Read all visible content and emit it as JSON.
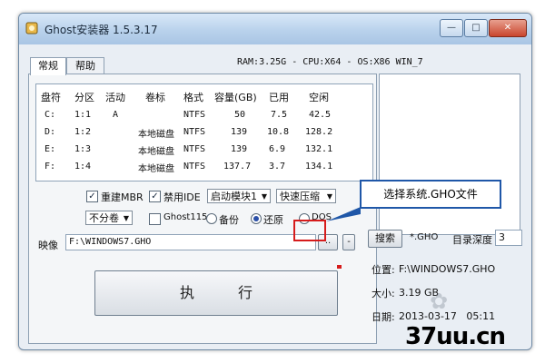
{
  "window": {
    "title": "Ghost安装器 1.5.3.17",
    "caption_buttons": {
      "minimize": "—",
      "maximize": "□",
      "close": "✕"
    }
  },
  "tabs": [
    {
      "label": "常规",
      "active": true
    },
    {
      "label": "帮助",
      "active": false
    }
  ],
  "sysinfo": "RAM:3.25G - CPU:X64 - OS:X86 WIN_7",
  "partition_table": {
    "columns": [
      "盘符",
      "分区",
      "活动",
      "卷标",
      "格式",
      "容量(GB)",
      "已用",
      "空闲"
    ],
    "rows": [
      [
        "C:",
        "1:1",
        "A",
        "",
        "NTFS",
        "50",
        "7.5",
        "42.5"
      ],
      [
        "D:",
        "1:2",
        "",
        "本地磁盘",
        "NTFS",
        "139",
        "10.8",
        "128.2"
      ],
      [
        "E:",
        "1:3",
        "",
        "本地磁盘",
        "NTFS",
        "139",
        "6.9",
        "132.1"
      ],
      [
        "F:",
        "1:4",
        "",
        "本地磁盘",
        "NTFS",
        "137.7",
        "3.7",
        "134.1"
      ]
    ]
  },
  "options": {
    "rebuild_mbr": {
      "label": "重建MBR",
      "checked": true
    },
    "disable_ide": {
      "label": "禁用IDE",
      "checked": true
    },
    "boot_module": "启动模块1",
    "compression": "快速压缩",
    "split": "不分卷",
    "ghost115": {
      "label": "Ghost115",
      "checked": false
    },
    "mode": {
      "backup": "备份",
      "restore": "还原",
      "dos": "DOS",
      "selected": "restore"
    }
  },
  "image": {
    "label": "映像",
    "path": "F:\\WINDOWS7.GHO",
    "browse_label": "..",
    "minus_label": "-"
  },
  "execute_label": "执行",
  "search": {
    "button_label": "搜索",
    "pattern": "*.GHO",
    "depth_label": "目录深度",
    "depth_value": "3"
  },
  "file_info": {
    "location_label": "位置:",
    "location_value": "F:\\WINDOWS7.GHO",
    "size_label": "大小:",
    "size_value": "3.19 GB",
    "date_label": "日期:",
    "date_value": "2013-03-17   05:11"
  },
  "callout_text": "选择系统.GHO文件",
  "watermark": "37uu.cn",
  "colors": {
    "callout_border": "#1f57a8",
    "highlight_red": "#d61c1c",
    "title_bar": "#b9d2ec"
  }
}
